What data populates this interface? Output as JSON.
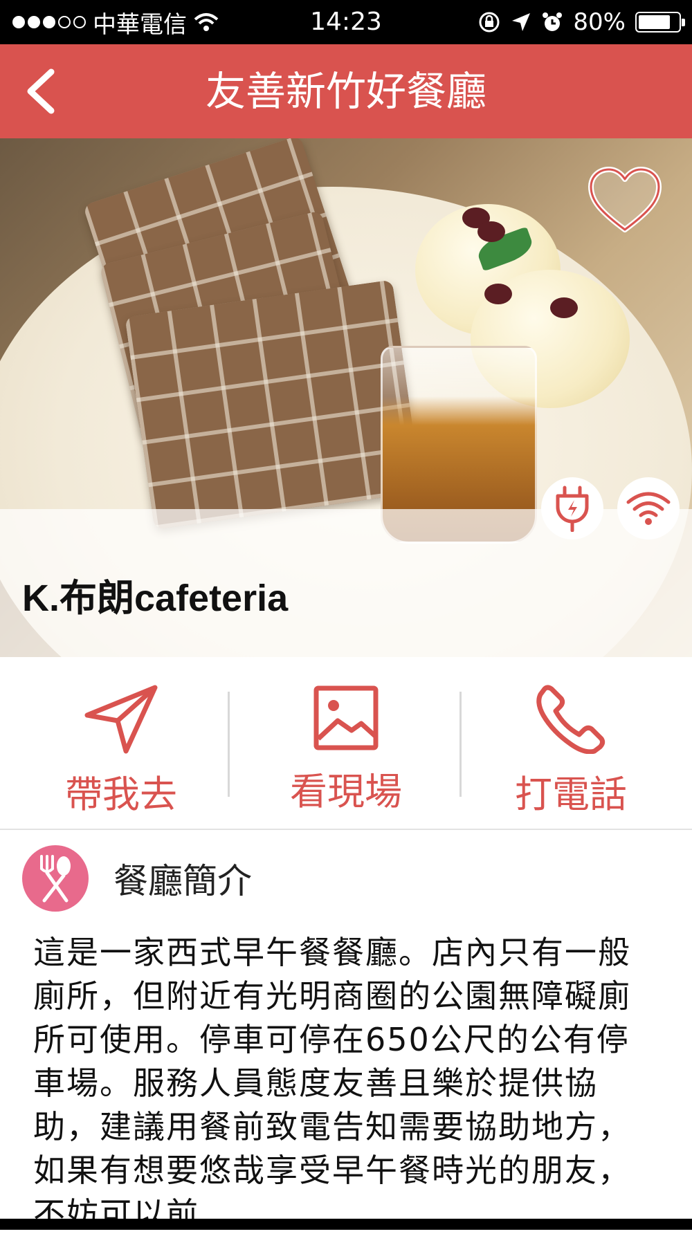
{
  "status_bar": {
    "carrier": "中華電信",
    "time": "14:23",
    "battery": "80%",
    "battery_level": 0.8
  },
  "nav": {
    "title": "友善新竹好餐廳",
    "back_icon": "chevron-left-icon"
  },
  "restaurant": {
    "name": "K.布朗cafeteria",
    "favorite_icon": "heart-icon",
    "amenities": [
      "power-plug-icon",
      "wifi-icon"
    ]
  },
  "actions": [
    {
      "label": "帶我去",
      "icon": "navigation-arrow-icon"
    },
    {
      "label": "看現場",
      "icon": "image-icon"
    },
    {
      "label": "打電話",
      "icon": "phone-icon"
    }
  ],
  "intro": {
    "title": "餐廳簡介",
    "icon": "fork-spoon-icon",
    "text": "這是一家西式早午餐餐廳。店內只有一般廁所，但附近有光明商圈的公園無障礙廁所可使用。停車可停在650公尺的公有停車場。服務人員態度友善且樂於提供協助，建議用餐前致電告知需要協助地方，如果有想要悠哉享受早午餐時光的朋友，不妨可以前"
  },
  "colors": {
    "accent": "#d9534f",
    "intro_icon_bg": "#e86a8c"
  }
}
